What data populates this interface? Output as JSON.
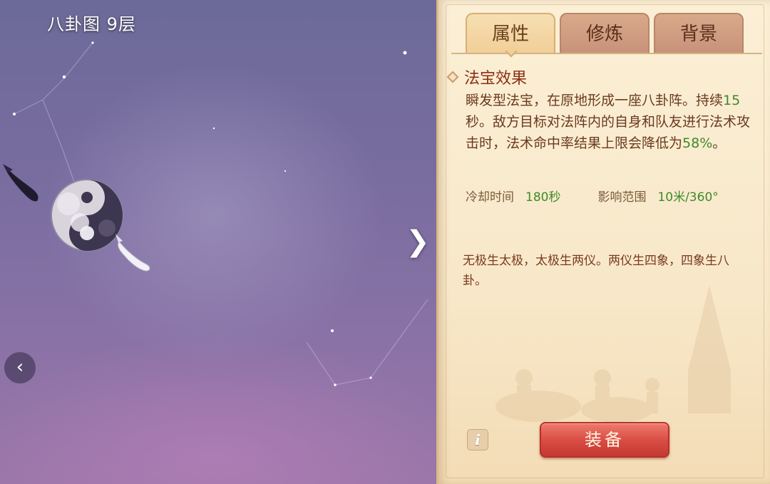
{
  "scene": {
    "title": "八卦图  9层",
    "next_arrow_icon": "chevron-right-icon",
    "prev_arrow_icon": "chevron-left-icon"
  },
  "panel": {
    "tabs": [
      {
        "label": "属性",
        "active": true
      },
      {
        "label": "修炼",
        "active": false
      },
      {
        "label": "背景",
        "active": false
      }
    ],
    "effect": {
      "title": "法宝效果",
      "desc_part1": "瞬发型法宝，在原地形成一座八卦阵。持续",
      "duration": "15",
      "desc_part2": "秒。敌方目标对法阵内的自身和队友进行法术攻击时，法术命中率结果上限会降低为",
      "rate": "58%",
      "desc_part3": "。"
    },
    "stats": {
      "cooldown_label": "冷却时间",
      "cooldown_value": "180秒",
      "range_label": "影响范围",
      "range_value": "10米/360°"
    },
    "lore": "无极生太极，太极生两仪。两仪生四象，四象生八卦。",
    "equip_label": "装备",
    "info_icon_label": "i"
  },
  "colors": {
    "accent_green": "#3f8a2a",
    "title_red": "#8a2f13",
    "button_red": "#d84a42"
  }
}
